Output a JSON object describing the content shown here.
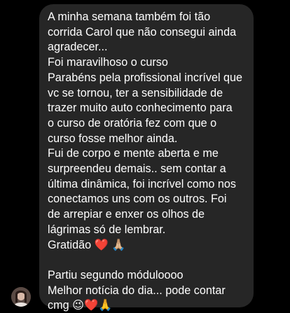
{
  "message": {
    "lines": [
      "A minha semana também foi tão",
      "corrida Carol que não consegui ainda",
      "agradecer...",
      "Foi maravilhoso o curso",
      "Parabéns pela profissional incrível que",
      "vc se tornou, ter a sensibilidade de",
      "trazer muito auto conhecimento para",
      "o curso de oratória fez com que o",
      "curso fosse melhor ainda.",
      "Fui de corpo e mente aberta e me",
      "surpreendeu demais.. sem contar a",
      "última dinâmica, foi incrível como nos",
      "conectamos uns com os outros. Foi",
      "de arrepiar e enxer os olhos de",
      "lágrimas só de lembrar.",
      "Gratidão ❤️ 🙏🏼",
      "",
      "Partiu segundo móduloooo",
      "Melhor notícia do dia... pode contar",
      "cmg 😉❤️🙏"
    ]
  },
  "colors": {
    "background": "#000000",
    "bubble": "#262626",
    "text": "#ffffff"
  },
  "avatar": {
    "icon": "profile-photo-avatar"
  }
}
